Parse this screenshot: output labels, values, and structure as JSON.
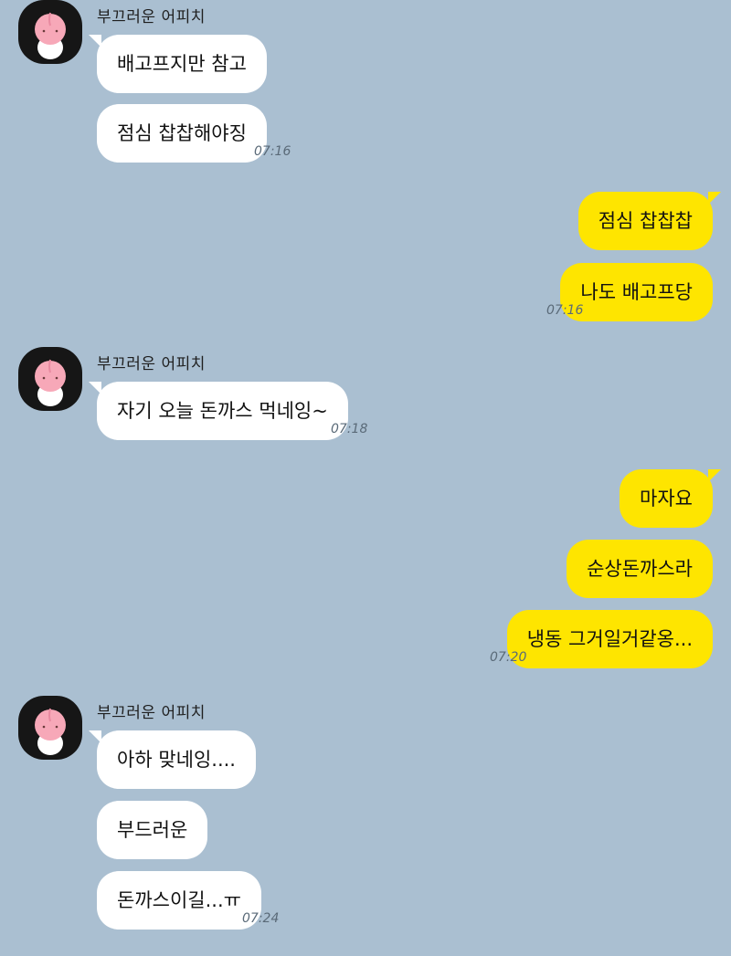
{
  "contact": {
    "name": "부끄러운 어피치",
    "avatar_icon": "peach-character-icon"
  },
  "messages": {
    "m1": "배고프지만 참고",
    "m2": "점심 찹찹해야징",
    "t1": "07:16",
    "m3": "점심 찹찹찹",
    "m4": "나도 배고프당",
    "t2": "07:16",
    "m5": "자기 오늘 돈까스 먹네잉~",
    "t3": "07:18",
    "m6": "마자요",
    "m7": "순상돈까스라",
    "m8": "냉동 그거일거같옹...",
    "t4": "07:20",
    "m9": "아하 맞네잉....",
    "m10": "부드러운",
    "m11": "돈까스이길...ㅠ",
    "t5": "07:24"
  },
  "colors": {
    "background": "#aabfd1",
    "incoming": "#ffffff",
    "outgoing": "#fee500"
  }
}
